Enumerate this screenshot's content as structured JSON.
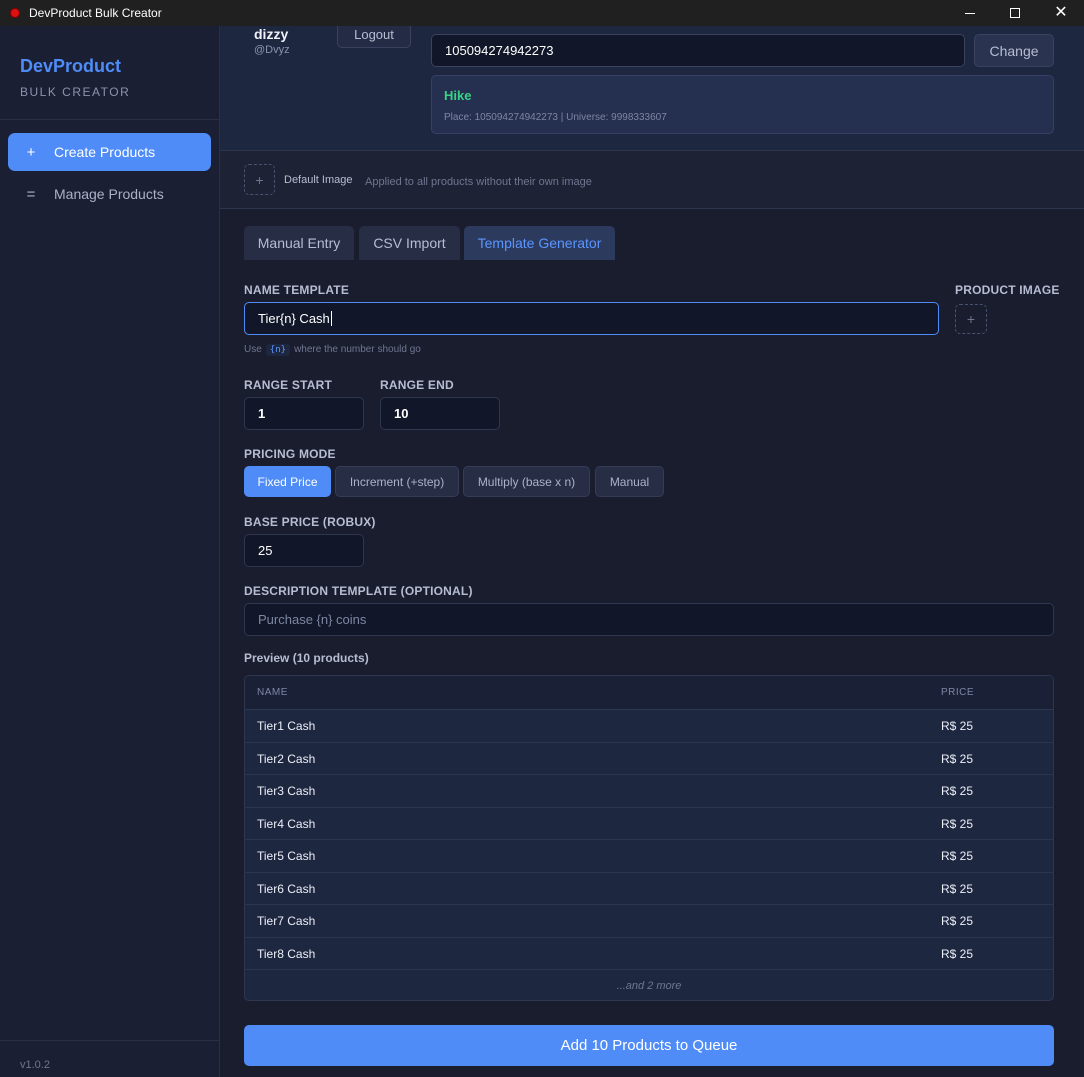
{
  "window": {
    "title": "DevProduct Bulk Creator"
  },
  "sidebar": {
    "brand": "DevProduct",
    "brand_sub": "BULK CREATOR",
    "items": [
      {
        "icon": "+",
        "label": "Create Products",
        "active": true
      },
      {
        "icon": "=",
        "label": "Manage Products",
        "active": false
      }
    ],
    "version": "v1.0.2"
  },
  "user": {
    "name": "dizzy",
    "handle": "@Dvyz",
    "logout_label": "Logout"
  },
  "place": {
    "input_value": "105094274942273",
    "change_label": "Change",
    "game_name": "Hike",
    "game_info": "Place: 105094274942273 | Universe: 9998333607"
  },
  "default_image": {
    "slot_icon": "+",
    "label": "Default Image",
    "hint": "Applied to all products without their own image"
  },
  "tabs": [
    {
      "label": "Manual Entry",
      "active": false
    },
    {
      "label": "CSV Import",
      "active": false
    },
    {
      "label": "Template Generator",
      "active": true
    }
  ],
  "template": {
    "name_label": "NAME TEMPLATE",
    "name_value": "Tier{n} Cash",
    "hint_prefix": "Use",
    "hint_code": "{n}",
    "hint_suffix": "where the number should go",
    "image_label": "PRODUCT IMAGE",
    "image_icon": "+",
    "range_start_label": "RANGE START",
    "range_start_value": "1",
    "range_end_label": "RANGE END",
    "range_end_value": "10",
    "pricing_label": "PRICING MODE",
    "pricing_modes": [
      {
        "label": "Fixed Price",
        "active": true
      },
      {
        "label": "Increment (+step)",
        "active": false
      },
      {
        "label": "Multiply (base x n)",
        "active": false
      },
      {
        "label": "Manual",
        "active": false
      }
    ],
    "base_price_label": "BASE PRICE (ROBUX)",
    "base_price_value": "25",
    "desc_label": "DESCRIPTION TEMPLATE (OPTIONAL)",
    "desc_placeholder": "Purchase {n} coins"
  },
  "preview": {
    "title": "Preview (10 products)",
    "col_name": "NAME",
    "col_price": "PRICE",
    "rows": [
      {
        "name": "Tier1 Cash",
        "price": "R$ 25"
      },
      {
        "name": "Tier2 Cash",
        "price": "R$ 25"
      },
      {
        "name": "Tier3 Cash",
        "price": "R$ 25"
      },
      {
        "name": "Tier4 Cash",
        "price": "R$ 25"
      },
      {
        "name": "Tier5 Cash",
        "price": "R$ 25"
      },
      {
        "name": "Tier6 Cash",
        "price": "R$ 25"
      },
      {
        "name": "Tier7 Cash",
        "price": "R$ 25"
      },
      {
        "name": "Tier8 Cash",
        "price": "R$ 25"
      }
    ],
    "more_text": "...and 2 more"
  },
  "add_button_label": "Add 10 Products to Queue"
}
